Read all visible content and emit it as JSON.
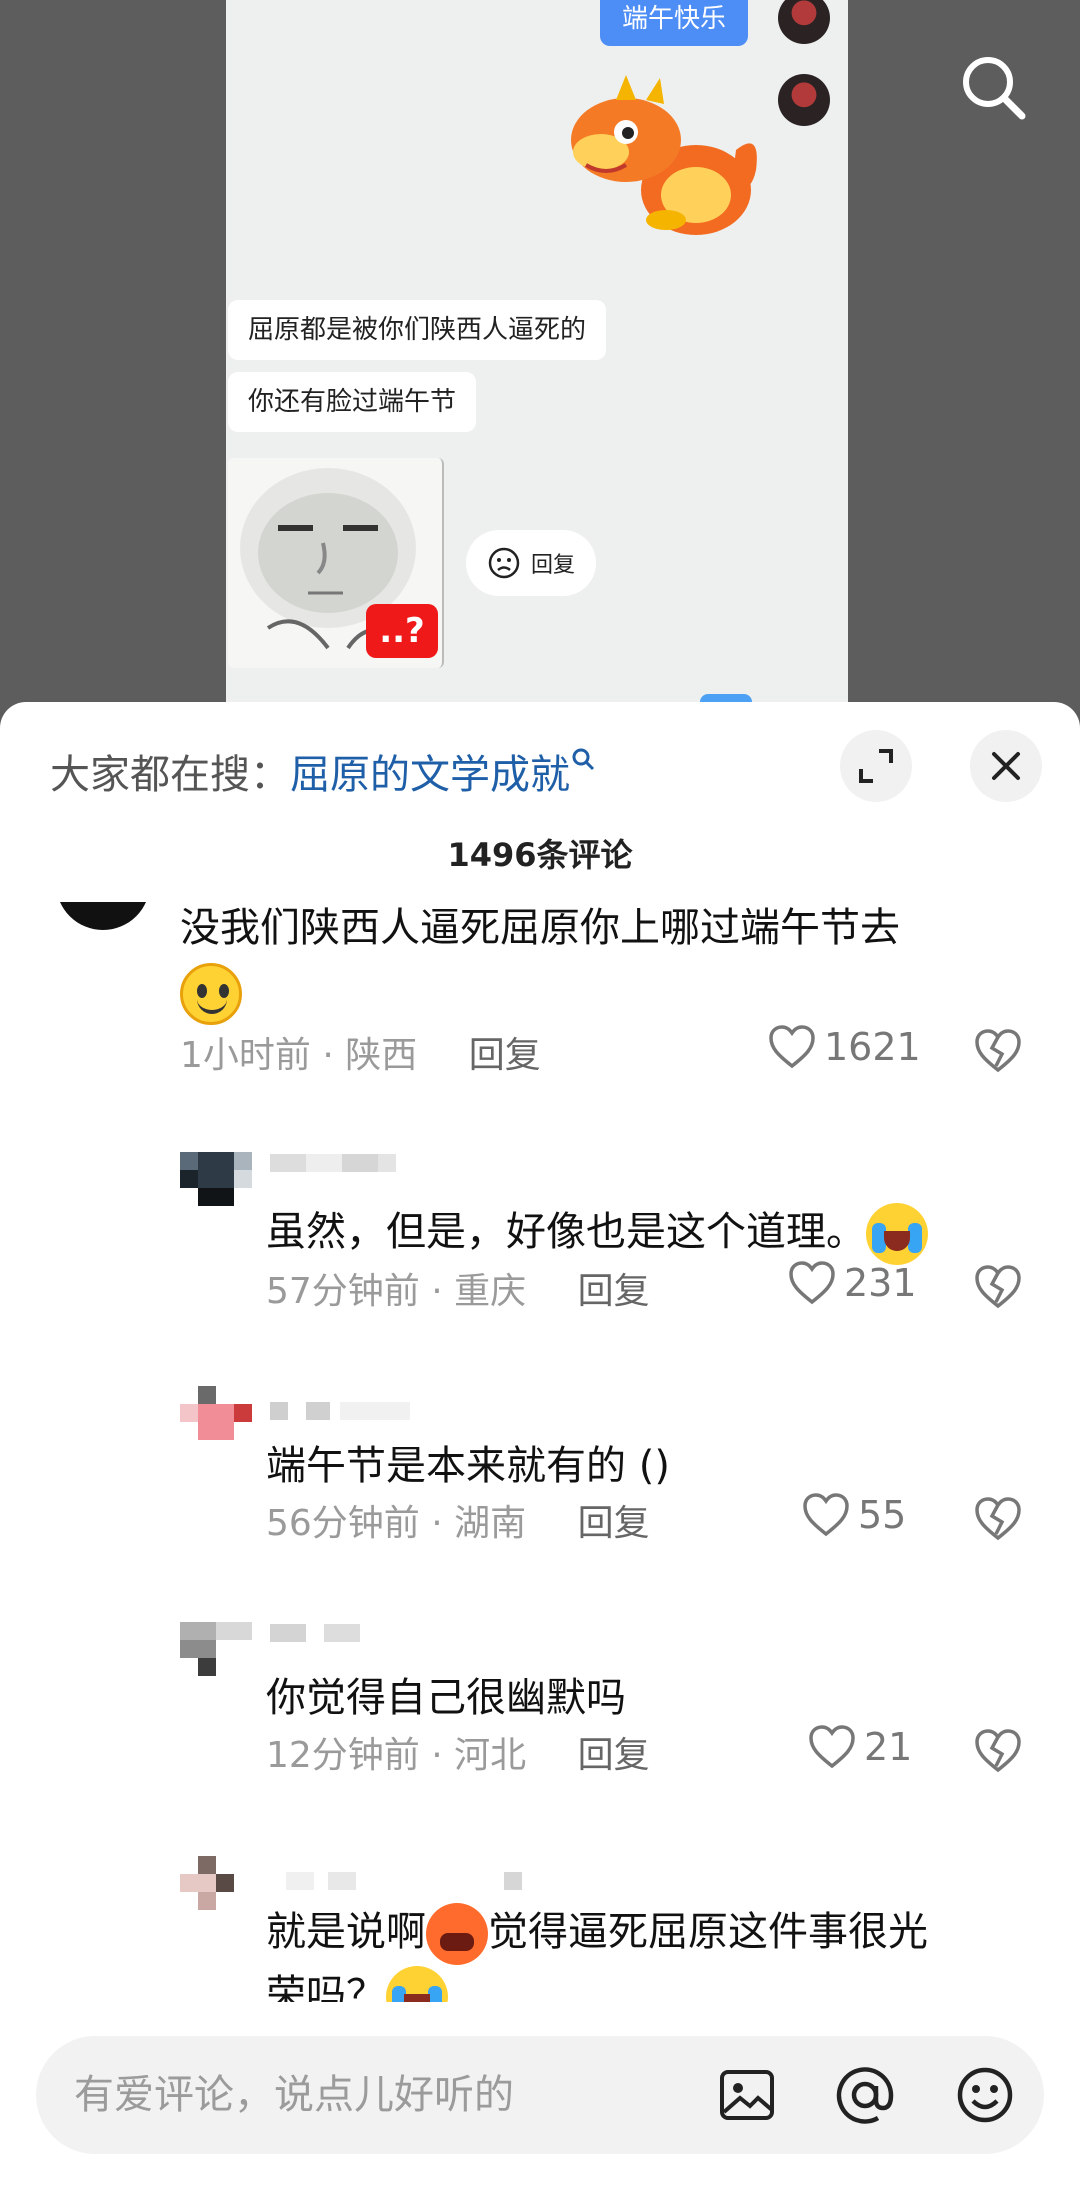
{
  "video": {
    "chat": {
      "sent_message": "端午快乐",
      "received_messages": [
        "屈原都是被你们陕西人逼死的",
        "你还有脸过端午节"
      ],
      "meme_badge": "..?",
      "reply_chip": "回复"
    },
    "search_icon": "search-icon"
  },
  "sheet": {
    "search_prefix": "大家都在搜：",
    "search_keyword": "屈原的文学成就",
    "comment_count": "1496条评论",
    "expand_icon": "expand-icon",
    "close_icon": "close-icon"
  },
  "comments": {
    "main": {
      "text": "没我们陕西人逼死屈原你上哪过端午节去",
      "time": "1小时前",
      "location": "陕西",
      "reply": "回复",
      "likes": "1621"
    },
    "replies": [
      {
        "text": "虽然，但是，好像也是这个道理。",
        "time": "57分钟前",
        "location": "重庆",
        "reply": "回复",
        "likes": "231"
      },
      {
        "text": "端午节是本来就有的 ()",
        "time": "56分钟前",
        "location": "湖南",
        "reply": "回复",
        "likes": "55"
      },
      {
        "text": "你觉得自己很幽默吗",
        "time": "12分钟前",
        "location": "河北",
        "reply": "回复",
        "likes": "21"
      },
      {
        "text_a": "就是说啊",
        "text_b": "觉得逼死屈原这件事很光",
        "text_c": "荣吗？"
      }
    ],
    "separator": "·"
  },
  "input": {
    "placeholder": "有爱评论，说点儿好听的",
    "image_icon": "image-icon",
    "at_icon": "at-icon",
    "emoji_icon": "emoji-icon"
  }
}
